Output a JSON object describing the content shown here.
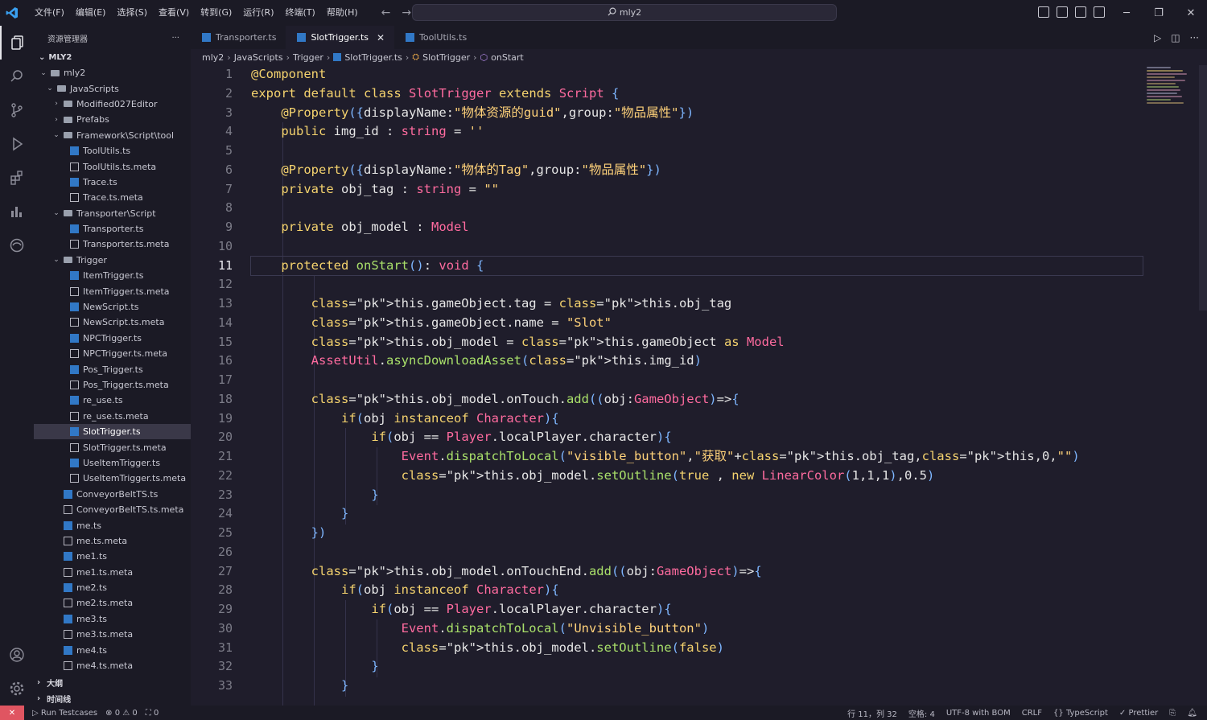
{
  "titlebar": {
    "menus": [
      "文件(F)",
      "编辑(E)",
      "选择(S)",
      "查看(V)",
      "转到(G)",
      "运行(R)",
      "终端(T)",
      "帮助(H)"
    ],
    "search_text": "mly2"
  },
  "explorer": {
    "title": "资源管理器",
    "root": "MLY2",
    "items": [
      {
        "label": "mly2",
        "kind": "folder"
      },
      {
        "label": "JavaScripts",
        "kind": "folder"
      },
      {
        "label": "Modified027Editor",
        "kind": "folder"
      },
      {
        "label": "Prefabs",
        "kind": "folder"
      },
      {
        "label": "Framework\\Script\\tool",
        "kind": "folder"
      },
      {
        "label": "ToolUtils.ts",
        "kind": "ts"
      },
      {
        "label": "ToolUtils.ts.meta",
        "kind": "meta"
      },
      {
        "label": "Trace.ts",
        "kind": "ts"
      },
      {
        "label": "Trace.ts.meta",
        "kind": "meta"
      },
      {
        "label": "Transporter\\Script",
        "kind": "folder"
      },
      {
        "label": "Transporter.ts",
        "kind": "ts"
      },
      {
        "label": "Transporter.ts.meta",
        "kind": "meta"
      },
      {
        "label": "Trigger",
        "kind": "folder"
      },
      {
        "label": "ItemTrigger.ts",
        "kind": "ts"
      },
      {
        "label": "ItemTrigger.ts.meta",
        "kind": "meta"
      },
      {
        "label": "NewScript.ts",
        "kind": "ts"
      },
      {
        "label": "NewScript.ts.meta",
        "kind": "meta"
      },
      {
        "label": "NPCTrigger.ts",
        "kind": "ts"
      },
      {
        "label": "NPCTrigger.ts.meta",
        "kind": "meta"
      },
      {
        "label": "Pos_Trigger.ts",
        "kind": "ts"
      },
      {
        "label": "Pos_Trigger.ts.meta",
        "kind": "meta"
      },
      {
        "label": "re_use.ts",
        "kind": "ts"
      },
      {
        "label": "re_use.ts.meta",
        "kind": "meta"
      },
      {
        "label": "SlotTrigger.ts",
        "kind": "ts"
      },
      {
        "label": "SlotTrigger.ts.meta",
        "kind": "meta"
      },
      {
        "label": "UseItemTrigger.ts",
        "kind": "ts"
      },
      {
        "label": "UseItemTrigger.ts.meta",
        "kind": "meta"
      },
      {
        "label": "ConveyorBeltTS.ts",
        "kind": "ts"
      },
      {
        "label": "ConveyorBeltTS.ts.meta",
        "kind": "meta"
      },
      {
        "label": "me.ts",
        "kind": "ts"
      },
      {
        "label": "me.ts.meta",
        "kind": "meta"
      },
      {
        "label": "me1.ts",
        "kind": "ts"
      },
      {
        "label": "me1.ts.meta",
        "kind": "meta"
      },
      {
        "label": "me2.ts",
        "kind": "ts"
      },
      {
        "label": "me2.ts.meta",
        "kind": "meta"
      },
      {
        "label": "me3.ts",
        "kind": "ts"
      },
      {
        "label": "me3.ts.meta",
        "kind": "meta"
      },
      {
        "label": "me4.ts",
        "kind": "ts"
      },
      {
        "label": "me4.ts.meta",
        "kind": "meta"
      }
    ],
    "sections": [
      "大纲",
      "时间线"
    ]
  },
  "tabs": [
    {
      "label": "Transporter.ts"
    },
    {
      "label": "SlotTrigger.ts"
    },
    {
      "label": "ToolUtils.ts"
    }
  ],
  "breadcrumb": [
    "mly2",
    "JavaScripts",
    "Trigger",
    "SlotTrigger.ts",
    "SlotTrigger",
    "onStart"
  ],
  "statusbar": {
    "run_label": "Run Testcases",
    "problems_errors": "0",
    "problems_warnings": "0",
    "ports": "0",
    "position": "行 11，列 32",
    "indent": "空格: 4",
    "encoding": "UTF-8 with BOM",
    "eol": "CRLF",
    "language": "TypeScript",
    "formatter": "Prettier"
  },
  "editor": {
    "line_numbers": [
      "1",
      "2",
      "3",
      "4",
      "5",
      "6",
      "7",
      "8",
      "9",
      "10",
      "11",
      "12",
      "13",
      "14",
      "15",
      "16",
      "17",
      "18",
      "19",
      "20",
      "21",
      "22",
      "23",
      "24",
      "25",
      "26",
      "27",
      "28",
      "29",
      "30",
      "31",
      "32",
      "33"
    ],
    "current_line": "11",
    "code": [
      "@Component",
      "export default class SlotTrigger extends Script {",
      "    @Property({displayName:\"物体资源的guid\",group:\"物品属性\"})",
      "    public img_id : string = ''",
      "",
      "    @Property({displayName:\"物体的Tag\",group:\"物品属性\"})",
      "    private obj_tag : string = \"\"",
      "",
      "    private obj_model : Model",
      "",
      "    protected onStart(): void {",
      "",
      "        this.gameObject.tag = this.obj_tag",
      "        this.gameObject.name = \"Slot\"",
      "        this.obj_model = this.gameObject as Model",
      "        AssetUtil.asyncDownloadAsset(this.img_id)",
      "",
      "        this.obj_model.onTouch.add((obj:GameObject)=>{",
      "            if(obj instanceof Character){",
      "                if(obj == Player.localPlayer.character){",
      "                    Event.dispatchToLocal(\"visible_button\",\"获取\"+this.obj_tag,this,0,\"\")",
      "                    this.obj_model.setOutline(true , new LinearColor(1,1,1),0.5)",
      "                }",
      "            }",
      "        })",
      "",
      "        this.obj_model.onTouchEnd.add((obj:GameObject)=>{",
      "            if(obj instanceof Character){",
      "                if(obj == Player.localPlayer.character){",
      "                    Event.dispatchToLocal(\"Unvisible_button\")",
      "                    this.obj_model.setOutline(false)",
      "                }",
      "            }"
    ]
  }
}
